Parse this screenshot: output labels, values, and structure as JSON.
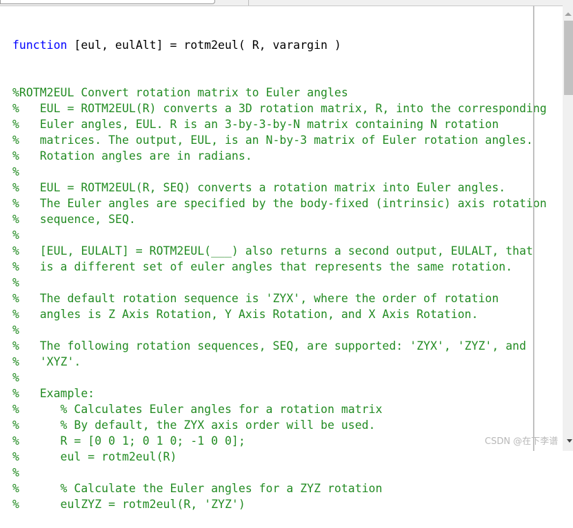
{
  "editor": {
    "signature": {
      "keyword": "function",
      "rest": " [eul, eulAlt] = rotm2eul( R, varargin )"
    },
    "comment_lines": [
      "%ROTM2EUL Convert rotation matrix to Euler angles",
      "%   EUL = ROTM2EUL(R) converts a 3D rotation matrix, R, into the corresponding",
      "%   Euler angles, EUL. R is an 3-by-3-by-N matrix containing N rotation",
      "%   matrices. The output, EUL, is an N-by-3 matrix of Euler rotation angles.",
      "%   Rotation angles are in radians.",
      "%",
      "%   EUL = ROTM2EUL(R, SEQ) converts a rotation matrix into Euler angles.",
      "%   The Euler angles are specified by the body-fixed (intrinsic) axis rotation",
      "%   sequence, SEQ.",
      "%",
      "%   [EUL, EULALT] = ROTM2EUL(___) also returns a second output, EULALT, that",
      "%   is a different set of euler angles that represents the same rotation.",
      "%",
      "%   The default rotation sequence is 'ZYX', where the order of rotation",
      "%   angles is Z Axis Rotation, Y Axis Rotation, and X Axis Rotation.",
      "%",
      "%   The following rotation sequences, SEQ, are supported: 'ZYX', 'ZYZ', and",
      "%   'XYZ'.",
      "%",
      "%   Example:",
      "%      % Calculates Euler angles for a rotation matrix",
      "%      % By default, the ZYX axis order will be used.",
      "%      R = [0 0 1; 0 1 0; -1 0 0];",
      "%      eul = rotm2eul(R)",
      "%",
      "%      % Calculate the Euler angles for a ZYZ rotation",
      "%      eulZYZ = rotm2eul(R, 'ZYZ')"
    ],
    "colors": {
      "keyword": "#0000ff",
      "comment": "#228b22",
      "text": "#000000"
    }
  },
  "watermark": "CSDN @在下李谱"
}
